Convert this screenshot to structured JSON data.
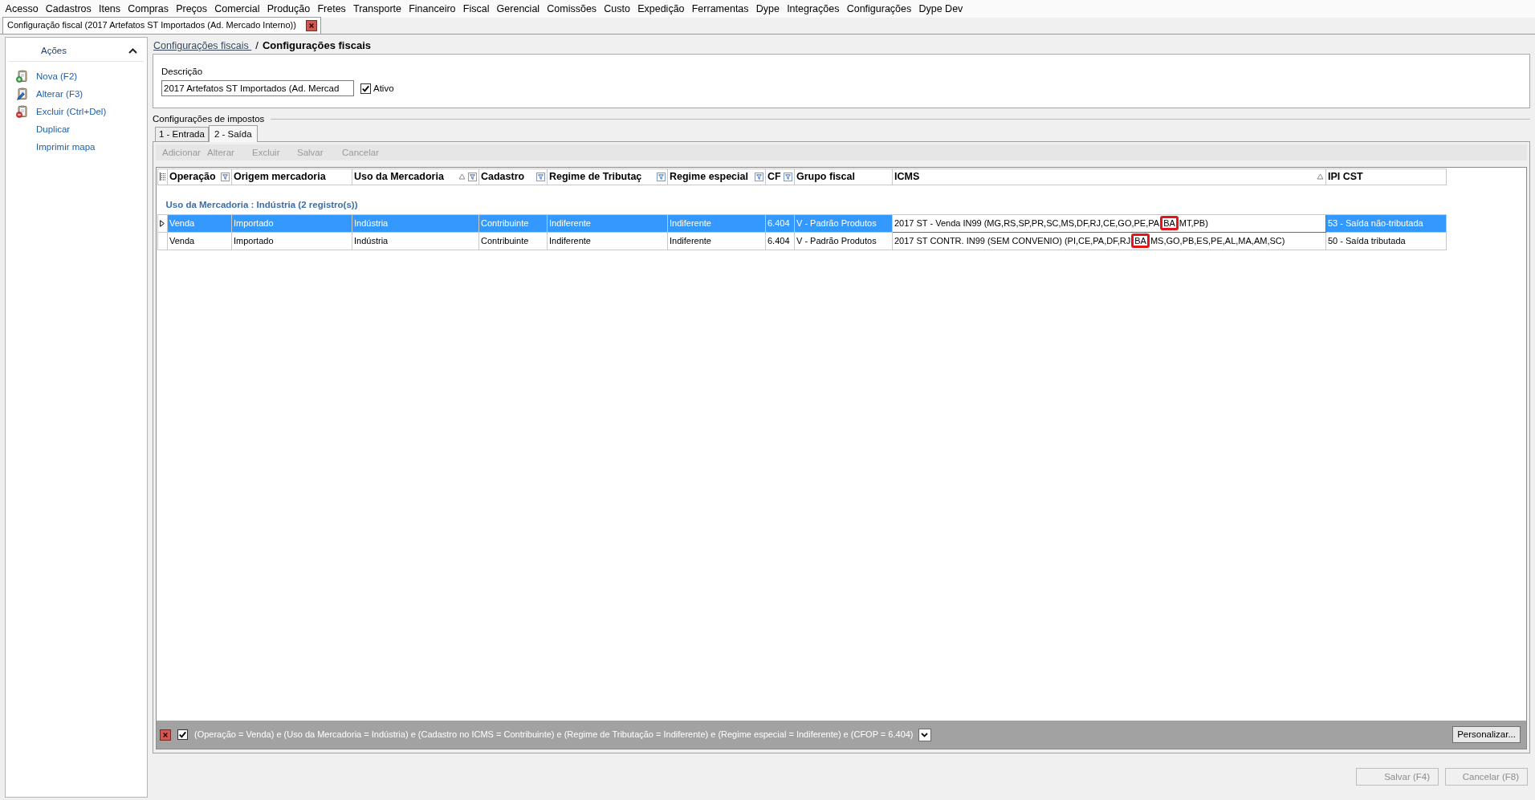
{
  "menu": [
    {
      "label": "Acesso"
    },
    {
      "label": "Cadastros"
    },
    {
      "label": "Itens"
    },
    {
      "label": "Compras"
    },
    {
      "label": "Preços"
    },
    {
      "label": "Comercial"
    },
    {
      "label": "Produção"
    },
    {
      "label": "Fretes"
    },
    {
      "label": "Transporte"
    },
    {
      "label": "Financeiro"
    },
    {
      "label": "Fiscal"
    },
    {
      "label": "Gerencial"
    },
    {
      "label": "Comissões"
    },
    {
      "label": "Custo"
    },
    {
      "label": "Expedição"
    },
    {
      "label": "Ferramentas"
    },
    {
      "label": "Dype"
    },
    {
      "label": "Integrações"
    },
    {
      "label": "Configurações"
    },
    {
      "label": "Dype Dev"
    }
  ],
  "document_tab": {
    "title": "Configuração fiscal (2017 Artefatos ST Importados (Ad. Mercado Interno))"
  },
  "sidebar": {
    "title": "Ações",
    "expanded": true,
    "items": [
      {
        "label": "Nova (F2)",
        "kind": "add"
      },
      {
        "label": "Alterar (F3)",
        "kind": "edit"
      },
      {
        "label": "Excluir (Ctrl+Del)",
        "kind": "delete"
      },
      {
        "label": "Duplicar",
        "kind": "plain"
      },
      {
        "label": "Imprimir mapa",
        "kind": "plain"
      }
    ]
  },
  "breadcrumb": {
    "link": "Configurações fiscais",
    "separator": "/",
    "current": "Configurações fiscais"
  },
  "description": {
    "label": "Descrição",
    "value": "2017 Artefatos ST Importados (Ad. Mercad",
    "active_label": "Ativo",
    "active": true
  },
  "taxes": {
    "title": "Configurações de impostos",
    "tabs": [
      {
        "label": "1 - Entrada",
        "selected": false
      },
      {
        "label": "2 - Saída",
        "selected": true
      }
    ],
    "toolbar": [
      {
        "label": "Adicionar",
        "disabled": true
      },
      {
        "label": "Alterar",
        "disabled": true
      },
      {
        "label": "Excluir",
        "disabled": true
      },
      {
        "label": "Salvar",
        "disabled": true
      },
      {
        "label": "Cancelar",
        "disabled": true
      }
    ],
    "table": {
      "columns": [
        {
          "label": "Operação",
          "filter": true,
          "sorted": false
        },
        {
          "label": "Origem mercadoria",
          "filter": false,
          "sorted": false
        },
        {
          "label": "Uso da Mercadoria",
          "filter": true,
          "sorted": true
        },
        {
          "label": "Cadastro",
          "filter": true,
          "sorted": false
        },
        {
          "label": "Regime de Tributaç",
          "filter": true,
          "sorted": false
        },
        {
          "label": "Regime especial",
          "filter": true,
          "sorted": false
        },
        {
          "label": "CF",
          "filter": true,
          "sorted": false
        },
        {
          "label": "Grupo fiscal",
          "filter": false,
          "sorted": false
        },
        {
          "label": "ICMS",
          "filter": false,
          "sorted": true
        },
        {
          "label": "IPI CST",
          "filter": false,
          "sorted": false
        }
      ],
      "group": "Uso da Mercadoria : Indústria (2 registro(s))",
      "rows": [
        {
          "selected": true,
          "cells": [
            {
              "text": "Venda",
              "focused": false
            },
            {
              "text": "Importado",
              "focused": false
            },
            {
              "text": "Indústria",
              "focused": false
            },
            {
              "text": "Contribuinte",
              "focused": false
            },
            {
              "text": "Indiferente",
              "focused": false
            },
            {
              "text": "Indiferente",
              "focused": false
            },
            {
              "text": "6.404",
              "focused": false
            },
            {
              "text": "V - Padrão Produtos",
              "focused": false
            },
            {
              "parts": [
                {
                  "text": "2017 ST - Venda IN99 (MG,RS,SP,PR,SC,MS,DF,RJ,CE,GO,PE,PA",
                  "marked": false
                },
                {
                  "text": "BA",
                  "marked": true
                },
                {
                  "text": "MT,PB)",
                  "marked": false
                }
              ],
              "focused": true
            },
            {
              "text": "53 - Saída não-tributada",
              "focused": false
            }
          ]
        },
        {
          "selected": false,
          "cells": [
            {
              "text": "Venda",
              "focused": false
            },
            {
              "text": "Importado",
              "focused": false
            },
            {
              "text": "Indústria",
              "focused": false
            },
            {
              "text": "Contribuinte",
              "focused": false
            },
            {
              "text": "Indiferente",
              "focused": false
            },
            {
              "text": "Indiferente",
              "focused": false
            },
            {
              "text": "6.404",
              "focused": false
            },
            {
              "text": "V - Padrão Produtos",
              "focused": false
            },
            {
              "parts": [
                {
                  "text": "2017 ST CONTR. IN99 (SEM CONVENIO) (PI,CE,PA,DF,RJ",
                  "marked": false
                },
                {
                  "text": "BA",
                  "marked": true
                },
                {
                  "text": "MS,GO,PB,ES,PE,AL,MA,AM,SC)",
                  "marked": false
                }
              ],
              "focused": false
            },
            {
              "text": "50 - Saída tributada",
              "focused": false
            }
          ]
        }
      ]
    },
    "filter_bar": {
      "enabled": true,
      "text": "(Operação = Venda) e (Uso da Mercadoria = Indústria) e (Cadastro no ICMS = Contribuinte) e (Regime de Tributação = Indiferente) e (Regime especial = Indiferente) e (CFOP = 6.404)",
      "customize": "Personalizar..."
    }
  },
  "footer_buttons": [
    {
      "label": "Salvar (F4)",
      "disabled": true
    },
    {
      "label": "Cancelar (F8)",
      "disabled": true
    }
  ]
}
